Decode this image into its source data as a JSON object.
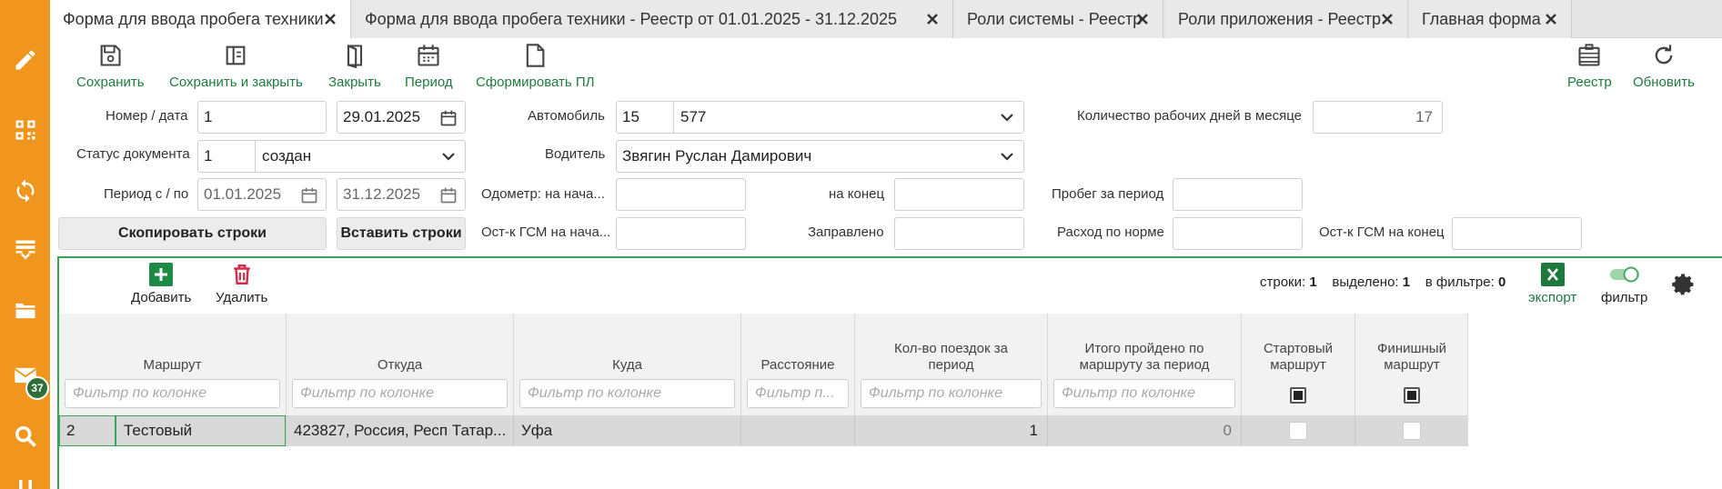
{
  "tabs": [
    {
      "label": "Форма для ввода пробега техники"
    },
    {
      "label": "Форма для ввода пробега техники - Реестр от 01.01.2025 - 31.12.2025"
    },
    {
      "label": "Роли системы - Реестр"
    },
    {
      "label": "Роли приложения - Реестр"
    },
    {
      "label": "Главная форма"
    }
  ],
  "sidebar": {
    "icons": [
      "pencil-icon",
      "qr-code-icon",
      "sync-icon",
      "download-list-icon",
      "folder-icon",
      "mail-icon",
      "search-icon"
    ],
    "mail_badge": "37"
  },
  "toolbar": {
    "save": "Сохранить",
    "save_close": "Сохранить и закрыть",
    "close": "Закрыть",
    "period": "Период",
    "generate_pl": "Сформировать ПЛ",
    "registry": "Реестр",
    "refresh": "Обновить"
  },
  "form": {
    "number_date_label": "Номер / дата",
    "number": "1",
    "date": "29.01.2025",
    "status_label": "Статус документа",
    "status_code": "1",
    "status_text": "создан",
    "period_label": "Период с / по",
    "period_from": "01.01.2025",
    "period_to": "31.12.2025",
    "car_label": "Автомобиль",
    "car_code": "15",
    "car_name": "577",
    "driver_label": "Водитель",
    "driver": "Звягин Руслан Дамирович",
    "odometer_start_label": "Одометр: на нача...",
    "odometer_end_label": "на конец",
    "mileage_period_label": "Пробег за период",
    "fuel_start_label": "Ост-к ГСМ на нача...",
    "refueled_label": "Заправлено",
    "norm_consumption_label": "Расход по норме",
    "fuel_end_label": "Ост-к ГСМ на конец",
    "work_days_label": "Количество рабочих дней в месяце",
    "work_days": "17",
    "copy_rows": "Скопировать строки",
    "paste_rows": "Вставить строки"
  },
  "grid": {
    "add": "Добавить",
    "delete": "Удалить",
    "rows_label": "строки:",
    "rows_count": "1",
    "selected_label": "выделено:",
    "selected_count": "1",
    "filter_label": "в фильтре:",
    "filter_count": "0",
    "export": "экспорт",
    "filter_toggle": "фильтр",
    "filter_on": true,
    "columns": {
      "route": "Маршрут",
      "from": "Откуда",
      "to": "Куда",
      "distance": "Расстояние",
      "trips": "Кол-во поездок за период",
      "total": "Итого пройдено по маршруту за период",
      "start_route": "Стартовый маршрут",
      "finish_route": "Финишный маршрут"
    },
    "filter_placeholder": "Фильтр по колонке",
    "filter_placeholder_short": "Фильтр п...",
    "rows": [
      {
        "route_code": "2",
        "route_name": "Тестовый",
        "from": "423827, Россия, Респ Татар...",
        "to": "Уфа",
        "distance": "",
        "trips": "1",
        "total": "0",
        "start_route": false,
        "finish_route": false
      }
    ]
  },
  "colors": {
    "sidebar": "#f0961e",
    "accent_green": "#1f7a3f",
    "add_green": "#1e8a45",
    "delete_red": "#d22b4b"
  }
}
